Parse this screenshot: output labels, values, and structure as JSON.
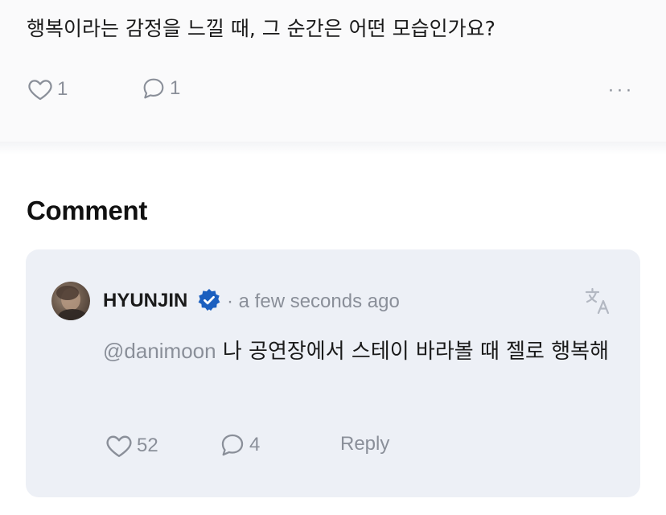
{
  "post": {
    "question": "행복이라는 감정을 느낄 때, 그 순간은 어떤 모습인가요?",
    "like_count": "1",
    "comment_count": "1",
    "more_label": "···"
  },
  "comments_section": {
    "title": "Comment"
  },
  "comment": {
    "username": "HYUNJIN",
    "verified": true,
    "timestamp": "· a few seconds ago",
    "mention": "@danimoon",
    "text": " 나 공연장에서 스테이 바라볼 때 젤로 행복해",
    "like_count": "52",
    "reply_count": "4",
    "reply_label": "Reply"
  },
  "icons": {
    "like": "heart-icon",
    "comment": "speech-bubble-icon",
    "more": "more-dots-icon",
    "verified": "verified-badge-icon",
    "translate": "translate-icon"
  },
  "colors": {
    "muted": "#8a8f99",
    "card_background": "#edf0f6",
    "verified_badge": "#1b5fbf"
  }
}
